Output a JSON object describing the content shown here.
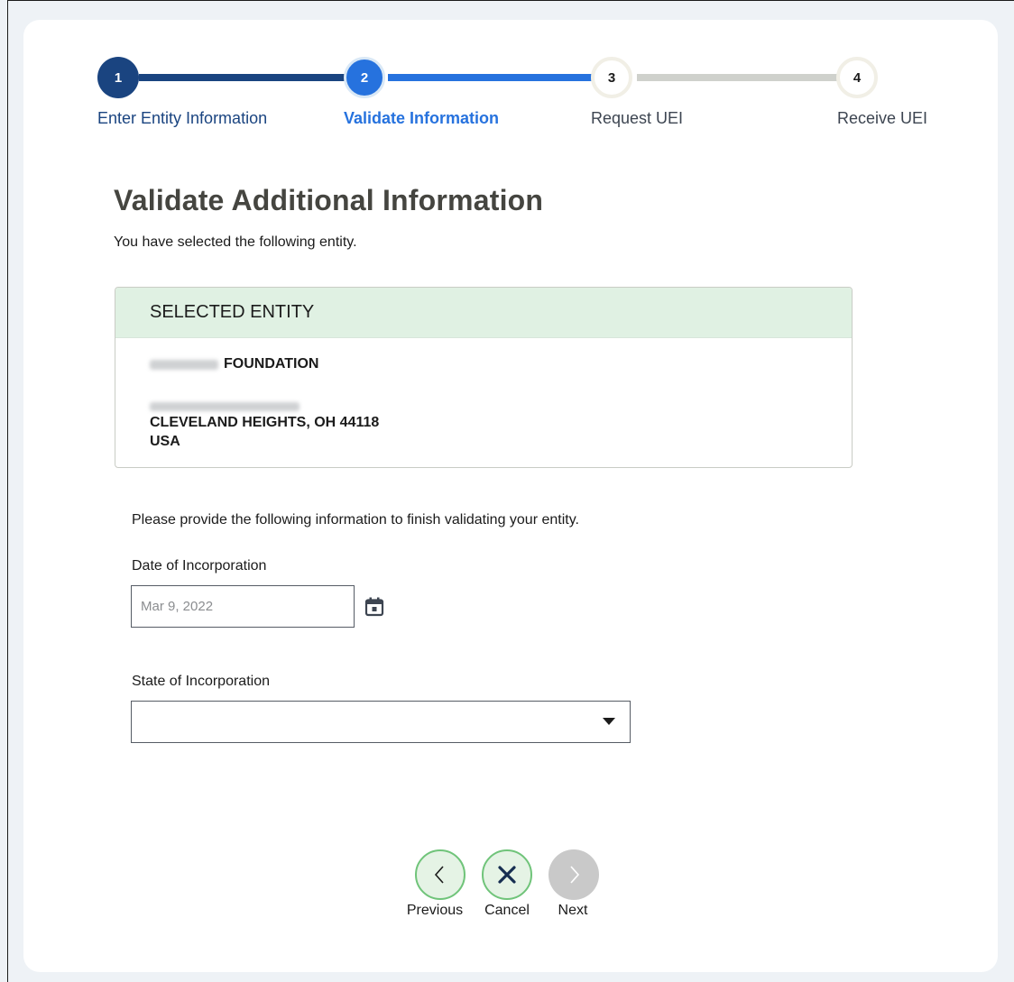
{
  "stepper": {
    "steps": [
      {
        "number": "1",
        "label": "Enter Entity Information",
        "state": "complete"
      },
      {
        "number": "2",
        "label": "Validate Information",
        "state": "current"
      },
      {
        "number": "3",
        "label": "Request UEI",
        "state": "upcoming"
      },
      {
        "number": "4",
        "label": "Receive UEI",
        "state": "upcoming"
      }
    ]
  },
  "page": {
    "title": "Validate Additional Information",
    "subtitle": "You have selected the following entity."
  },
  "entity": {
    "header": "SELECTED ENTITY",
    "name_suffix": "FOUNDATION",
    "city_state_zip": "CLEVELAND HEIGHTS, OH 44118",
    "country": "USA"
  },
  "form": {
    "instructions": "Please provide the following information to finish validating your entity.",
    "date_label": "Date of Incorporation",
    "date_value": "Mar 9, 2022",
    "state_label": "State of Incorporation",
    "state_value": ""
  },
  "nav": {
    "previous_label": "Previous",
    "cancel_label": "Cancel",
    "next_label": "Next"
  },
  "colors": {
    "step_complete": "#1a4480",
    "step_current": "#2672de",
    "step_upcoming": "#cfd1cc",
    "entity_header_bg": "#e0f1e3",
    "nav_active_border": "#70c47a",
    "nav_disabled": "#c9c9c9"
  },
  "icons": {
    "calendar": "calendar-icon",
    "dropdown": "caret-down-icon",
    "previous": "chevron-left-icon",
    "cancel": "close-icon",
    "next": "chevron-right-icon"
  }
}
